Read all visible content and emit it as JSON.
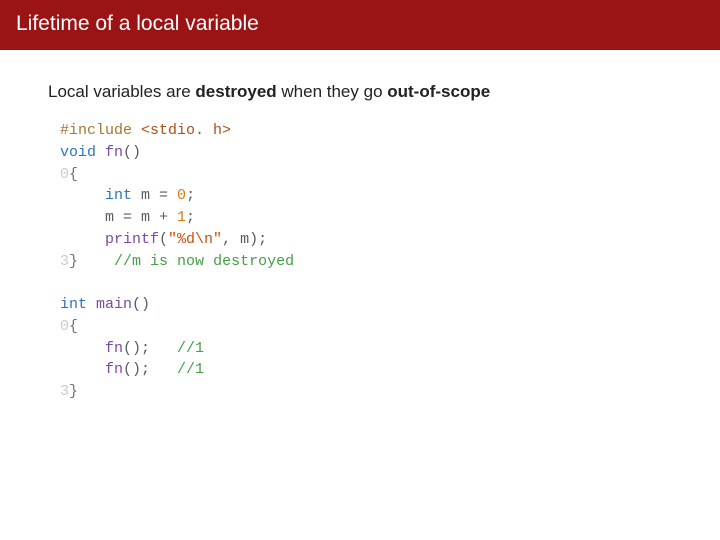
{
  "title": "Lifetime of a local variable",
  "description": {
    "pre": "Local variables are ",
    "bold1": "destroyed",
    "mid": " when they go ",
    "bold2": "out-of-scope"
  },
  "code": {
    "l01_pp": "#include",
    "l01_inc": " <stdio. h>",
    "l02_kw": "void",
    "l02_fn": " fn",
    "l02_rest": "()",
    "l03_gut": "0",
    "l03_brace": "{",
    "l04_pad": "     ",
    "l04_kw": "int",
    "l04_rest_a": " m = ",
    "l04_num": "0",
    "l04_rest_b": ";",
    "l05_pad": "     ",
    "l05_a": "m = m + ",
    "l05_num": "1",
    "l05_b": ";",
    "l06_pad": "     ",
    "l06_fn": "printf",
    "l06_a": "(",
    "l06_str": "\"%d\\n\"",
    "l06_b": ", m);",
    "l07_gut": "3",
    "l07_brace": "}",
    "l07_pad": "    ",
    "l07_cmt": "//m is now destroyed",
    "l09_kw": "int",
    "l09_fn": " main",
    "l09_rest": "()",
    "l10_gut": "0",
    "l10_brace": "{",
    "l11_pad": "     ",
    "l11_fn": "fn",
    "l11_rest": "();   ",
    "l11_cmt": "//1",
    "l12_pad": "     ",
    "l12_fn": "fn",
    "l12_rest": "();   ",
    "l12_cmt": "//1",
    "l13_gut": "3",
    "l13_brace": "}"
  }
}
